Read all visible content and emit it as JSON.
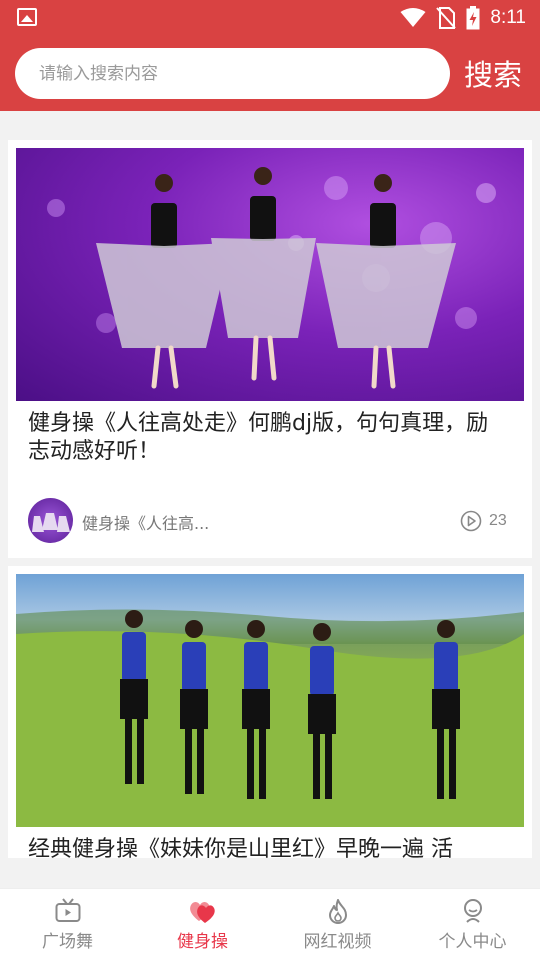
{
  "status_bar": {
    "time": "8:11",
    "icons": [
      "image-icon",
      "wifi-icon",
      "no-sim-icon",
      "battery-charging-icon"
    ]
  },
  "search": {
    "placeholder": "请输入搜索内容",
    "button_label": "搜索"
  },
  "videos": [
    {
      "title": "健身操《人往高处走》何鹏dj版，句句真理，励志动感好听！",
      "author": "健身操《人往高...",
      "play_count": "23"
    },
    {
      "title": "经典健身操《妹妹你是山里红》早晚一遍 活"
    }
  ],
  "tabs": [
    {
      "label": "广场舞",
      "icon": "tv-icon",
      "active": false
    },
    {
      "label": "健身操",
      "icon": "heart-icon",
      "active": true
    },
    {
      "label": "网红视频",
      "icon": "flame-icon",
      "active": false
    },
    {
      "label": "个人中心",
      "icon": "person-icon",
      "active": false
    }
  ],
  "colors": {
    "brand": "#d94242",
    "active_tab": "#e8374a"
  }
}
